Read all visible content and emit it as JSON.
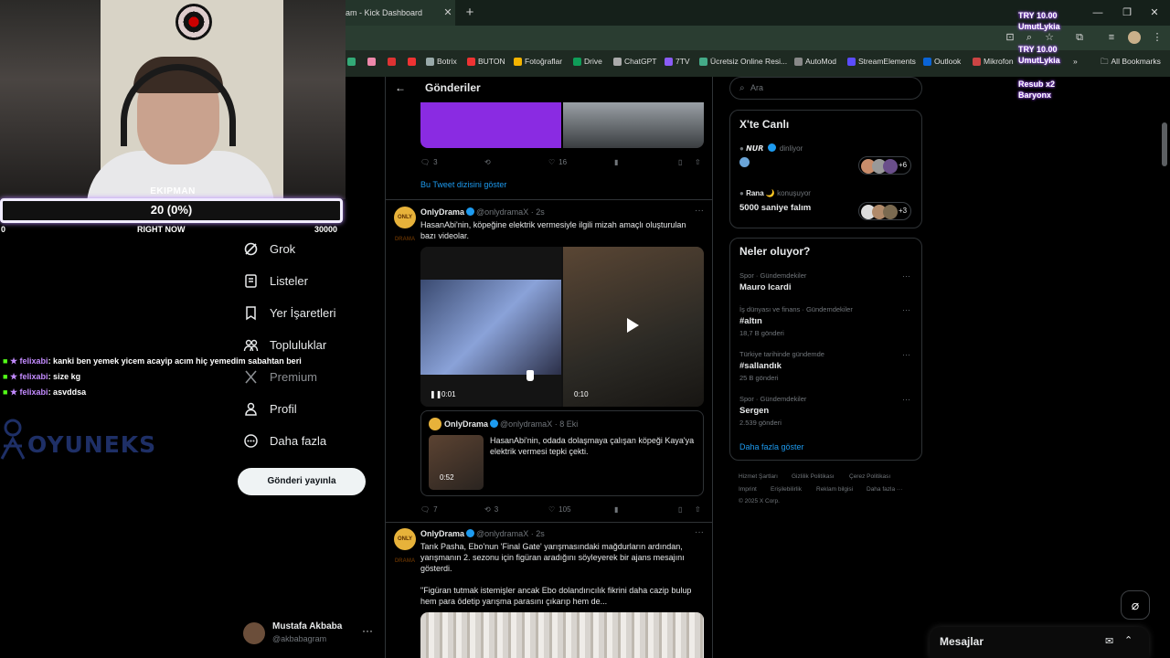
{
  "browser": {
    "tab_title": "am - Kick Dashboard",
    "bookmarks": [
      {
        "label": "Botrix",
        "color": "#9aa"
      },
      {
        "label": "BUTON",
        "color": "#e33"
      },
      {
        "label": "Fotoğraflar",
        "color": "#f4b400"
      },
      {
        "label": "Drive",
        "color": "#0f9d58"
      },
      {
        "label": "ChatGPT",
        "color": "#aaa"
      },
      {
        "label": "7TV",
        "color": "#8a5cf6"
      },
      {
        "label": "Ücretsiz Online Resi...",
        "color": "#4a8"
      },
      {
        "label": "AutoMod",
        "color": "#888"
      },
      {
        "label": "StreamElements",
        "color": "#5b4cff"
      },
      {
        "label": "Outlook",
        "color": "#0a64d6"
      },
      {
        "label": "Mikrofon",
        "color": "#c44"
      }
    ],
    "all_bookmarks": "All Bookmarks",
    "more_bookmarks": "»"
  },
  "overlay": {
    "goal_label": "EKIPMAN",
    "goal_value": "20 (0%)",
    "goal_min": "0",
    "goal_time": "RIGHT NOW",
    "goal_max": "30000",
    "chat": [
      {
        "user": "felixabi",
        "text": ": kanki ben yemek yicem acayip acım hiç yemedim sabahtan beri"
      },
      {
        "user": "felixabi",
        "text": ": size kg"
      },
      {
        "user": "felixabi",
        "text": ": asvddsa"
      }
    ],
    "brand": "OYUNEKS",
    "alerts": [
      "TRY 10.00",
      "UmutLykia",
      "TRY 10.00",
      "UmutLykia",
      "Resub x2",
      "Baryonx"
    ]
  },
  "nav": {
    "items": [
      {
        "label": "Grok",
        "icon": "grok-icon",
        "dim": false
      },
      {
        "label": "Listeler",
        "icon": "list-icon",
        "dim": false
      },
      {
        "label": "Yer İşaretleri",
        "icon": "bookmark-icon",
        "dim": false
      },
      {
        "label": "Topluluklar",
        "icon": "communities-icon",
        "dim": false
      },
      {
        "label": "Premium",
        "icon": "x-logo-icon",
        "dim": true
      },
      {
        "label": "Profil",
        "icon": "person-icon",
        "dim": false
      },
      {
        "label": "Daha fazla",
        "icon": "more-circle-icon",
        "dim": false
      }
    ],
    "post_button": "Gönderi yayınla",
    "profile_name": "Mustafa Akbaba",
    "profile_handle": "@akbabagram",
    "profile_more": "···"
  },
  "timeline": {
    "title": "Gönderiler",
    "post0": {
      "replies": "3",
      "reposts": "",
      "likes": "16",
      "thread_link": "Bu Tweet dizisini göster"
    },
    "post1": {
      "name": "OnlyDrama",
      "handle": "@onlydramaX · 2s",
      "text": "HasanAbi'nin, köpeğine elektrik vermesiyle ilgili mizah amaçlı oluşturulan bazı videolar.",
      "video1_time": "0:01",
      "video2_time": "0:10",
      "quote_name": "OnlyDrama",
      "quote_handle": "@onlydramaX · 8 Eki",
      "quote_text": "HasanAbi'nin, odada dolaşmaya çalışan köpeği Kaya'ya elektrik vermesi tepki çekti.",
      "quote_time": "0:52",
      "replies": "7",
      "reposts": "3",
      "likes": "105"
    },
    "post2": {
      "name": "OnlyDrama",
      "handle": "@onlydramaX · 2s",
      "text1": "Tarık Pasha, Ebo'nun 'Final Gate' yarışmasındaki mağdurların ardından, yarışmanın 2. sezonu için figüran aradığını söyleyerek bir ajans mesajını gösterdi.",
      "text2": "\"Figüran tutmak istemişler ancak Ebo dolandırıcılık fikrini daha cazip bulup hem para ödetip yarışma parasını çıkarıp hem de..."
    },
    "avatar_text": "ONLY DRAMA"
  },
  "right": {
    "search_placeholder": "Ara",
    "live": {
      "title": "X'te Canlı",
      "row1_user": "𝙉𝙐𝙍",
      "row1_status": "dinliyor",
      "row1_count": "+6",
      "row2_user": "Rana 🌙",
      "row2_status": "konuşuyor",
      "row2_title": "5000 saniye falım",
      "row2_count": "+3"
    },
    "trends": {
      "title": "Neler oluyor?",
      "items": [
        {
          "cat": "Spor · Gündemdekiler",
          "name": "Mauro Icardi",
          "count": ""
        },
        {
          "cat": "İş dünyası ve finans · Gündemdekiler",
          "name": "#altın",
          "count": "18,7 B gönderi"
        },
        {
          "cat": "Türkiye tarihinde gündemde",
          "name": "#sallandık",
          "count": "25 B gönderi"
        },
        {
          "cat": "Spor · Gündemdekiler",
          "name": "Sergen",
          "count": "2.539 gönderi"
        }
      ],
      "show_more": "Daha fazla göster"
    },
    "footer": [
      "Hizmet Şartları",
      "Gizlilik Politikası",
      "Çerez Politikası",
      "Imprint",
      "Erişilebilirlik",
      "Reklam bilgisi",
      "Daha fazla ···",
      "© 2025 X Corp."
    ],
    "messages_title": "Mesajlar"
  }
}
